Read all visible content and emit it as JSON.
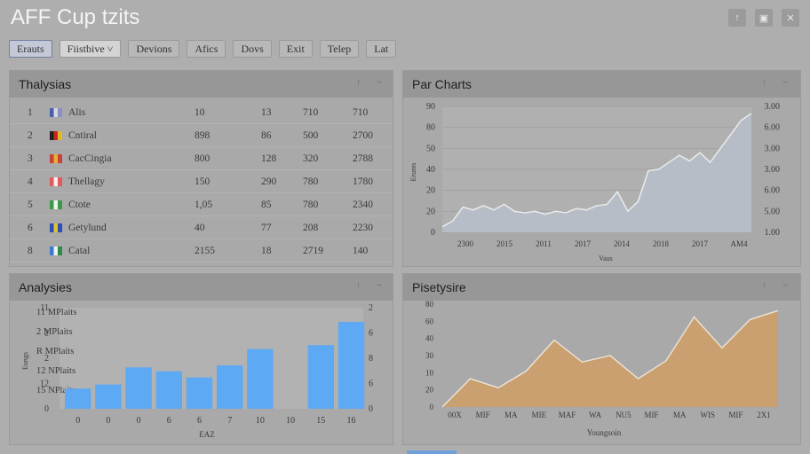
{
  "app": {
    "title": "AFF Cup tzits",
    "window_icons": [
      "pin-icon",
      "lock-icon",
      "close-icon"
    ],
    "window_icon_glyphs": [
      "↑",
      "▣",
      "✕"
    ]
  },
  "toolbar": {
    "items": [
      {
        "label": "Erauts",
        "active": true
      },
      {
        "label": "Fiistbive ˅",
        "select": true
      },
      {
        "label": "Devions"
      },
      {
        "label": "Afics"
      },
      {
        "label": "Dovs"
      },
      {
        "label": "Exit"
      },
      {
        "label": "Telep"
      },
      {
        "label": "Lat"
      }
    ]
  },
  "panels": {
    "table": {
      "title": "Thalysias",
      "rows": [
        {
          "rank": "1",
          "team": "Alis",
          "flag": [
            "#4a5fb0",
            "#d8d8d8",
            "#8a8fc6"
          ],
          "c1": "10",
          "c2": "13",
          "c3": "710",
          "c4": "710"
        },
        {
          "rank": "2",
          "team": "Cntiral",
          "flag": [
            "#222222",
            "#c22a1f",
            "#e0b82a"
          ],
          "c1": "898",
          "c2": "86",
          "c3": "500",
          "c4": "2700"
        },
        {
          "rank": "3",
          "team": "CacCingia",
          "flag": [
            "#c9413a",
            "#e3b233",
            "#c9413a"
          ],
          "c1": "800",
          "c2": "128",
          "c3": "320",
          "c4": "2788"
        },
        {
          "rank": "4",
          "team": "Thellagy",
          "flag": [
            "#e25a5a",
            "#f0f0f0",
            "#e25a5a"
          ],
          "c1": "150",
          "c2": "290",
          "c3": "780",
          "c4": "1780"
        },
        {
          "rank": "5",
          "team": "Ctote",
          "flag": [
            "#3b9a45",
            "#f1f1f1",
            "#3b9a45"
          ],
          "c1": "1,05",
          "c2": "85",
          "c3": "780",
          "c4": "2340"
        },
        {
          "rank": "6",
          "team": "Getylund",
          "flag": [
            "#2e4fb8",
            "#e2c22e",
            "#2e4fb8"
          ],
          "c1": "40",
          "c2": "77",
          "c3": "208",
          "c4": "2230"
        },
        {
          "rank": "8",
          "team": "Catal",
          "flag": [
            "#3a7bd0",
            "#f0f0f0",
            "#2f8a4a"
          ],
          "c1": "2155",
          "c2": "18",
          "c3": "2719",
          "c4": "140"
        }
      ]
    },
    "line": {
      "title": "Par Charts"
    },
    "bars": {
      "title": "Analysies"
    },
    "area": {
      "title": "Pisetysire"
    },
    "panel_controls": [
      "↑",
      "−"
    ]
  },
  "chart_data": [
    {
      "type": "line",
      "ylabel": "Erunts",
      "xlabel": "Vaus",
      "ylim": [
        0,
        90
      ],
      "y_ticks_left": [
        "0",
        "20",
        "20",
        "40",
        "50",
        "80",
        "90"
      ],
      "y_ticks_right": [
        "1.00",
        "5.00",
        "6.00",
        "3.00",
        "3.00",
        "6.00",
        "3.00"
      ],
      "categories": [
        "2300",
        "2015",
        "2011",
        "2017",
        "2014",
        "2018",
        "2017",
        "AM4"
      ],
      "values": [
        4,
        8,
        18,
        16,
        19,
        16,
        20,
        15,
        14,
        15,
        13,
        15,
        14,
        17,
        16,
        19,
        20,
        29,
        15,
        22,
        44,
        45,
        50,
        55,
        51,
        57,
        50,
        60,
        70,
        80,
        85
      ],
      "color": "#e8e8e8",
      "fill": "#b6bdc6"
    },
    {
      "type": "bar",
      "ylabel": "Eungs",
      "xlabel": "EAZ",
      "legend": [
        "11 MPlaits",
        "2 MPlaits",
        "R MPlaits",
        "12 NPlaits",
        "15 NPlaits"
      ],
      "categories": [
        "0",
        "0",
        "0",
        "6",
        "6",
        "7",
        "10",
        "10",
        "15",
        "16"
      ],
      "values": [
        2,
        2.4,
        4.1,
        3.7,
        3.1,
        4.3,
        5.9,
        0,
        6.3,
        8.6
      ],
      "ylim": [
        0,
        10
      ],
      "y_ticks_left": [
        "0",
        "12",
        "2",
        "2",
        "11"
      ],
      "y_ticks_right": [
        "0",
        "6",
        "8",
        "6",
        "2"
      ],
      "color": "#5ea9f3"
    },
    {
      "type": "area",
      "xlabel": "Youngsoin",
      "ylim": [
        0,
        80
      ],
      "y_ticks": [
        "0",
        "20",
        "10",
        "30",
        "40",
        "60",
        "80"
      ],
      "categories": [
        "00X",
        "MIF",
        "MA",
        "MIE",
        "MAF",
        "WA",
        "NU5",
        "MIF",
        "MA",
        "WIS",
        "MIF",
        "2X1"
      ],
      "values": [
        0,
        22,
        15,
        28,
        52,
        35,
        40,
        22,
        36,
        70,
        46,
        68,
        75
      ],
      "color": "#caa070",
      "line": "#ece4d6"
    }
  ]
}
